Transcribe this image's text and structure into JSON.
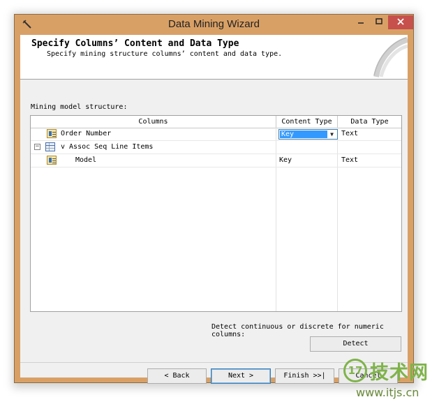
{
  "window": {
    "title": "Data Mining Wizard",
    "controls": {
      "minimize": "—",
      "maximize": "☐",
      "close": "✕"
    }
  },
  "header": {
    "title": "Specify Columns’ Content and Data Type",
    "subtitle": "Specify mining structure columns’ content and data type."
  },
  "grid": {
    "section_label": "Mining model structure:",
    "headers": {
      "columns": "Columns",
      "content_type": "Content Type",
      "data_type": "Data Type"
    },
    "rows": [
      {
        "name": "Order Number",
        "content_type": "Key",
        "data_type": "Text",
        "icon": "column-icon"
      },
      {
        "name": "v Assoc Seq Line Items",
        "content_type": "",
        "data_type": "",
        "icon": "table-icon",
        "expander": "−"
      },
      {
        "name": "Model",
        "content_type": "Key",
        "data_type": "Text",
        "icon": "column-icon"
      }
    ]
  },
  "detect": {
    "label": "Detect continuous or discrete for numeric columns:",
    "button": "Detect"
  },
  "footer": {
    "back": "< Back",
    "next": "Next >",
    "finish": "Finish >>|",
    "cancel": "Cancel"
  },
  "watermark": {
    "logo": "17",
    "text": "技术网",
    "url": "www.itjs.cn"
  },
  "colors": {
    "title_bar": "#d9a066",
    "close_button": "#c7504c",
    "selection": "#3399ff",
    "watermark_green": "#7fb34a"
  }
}
